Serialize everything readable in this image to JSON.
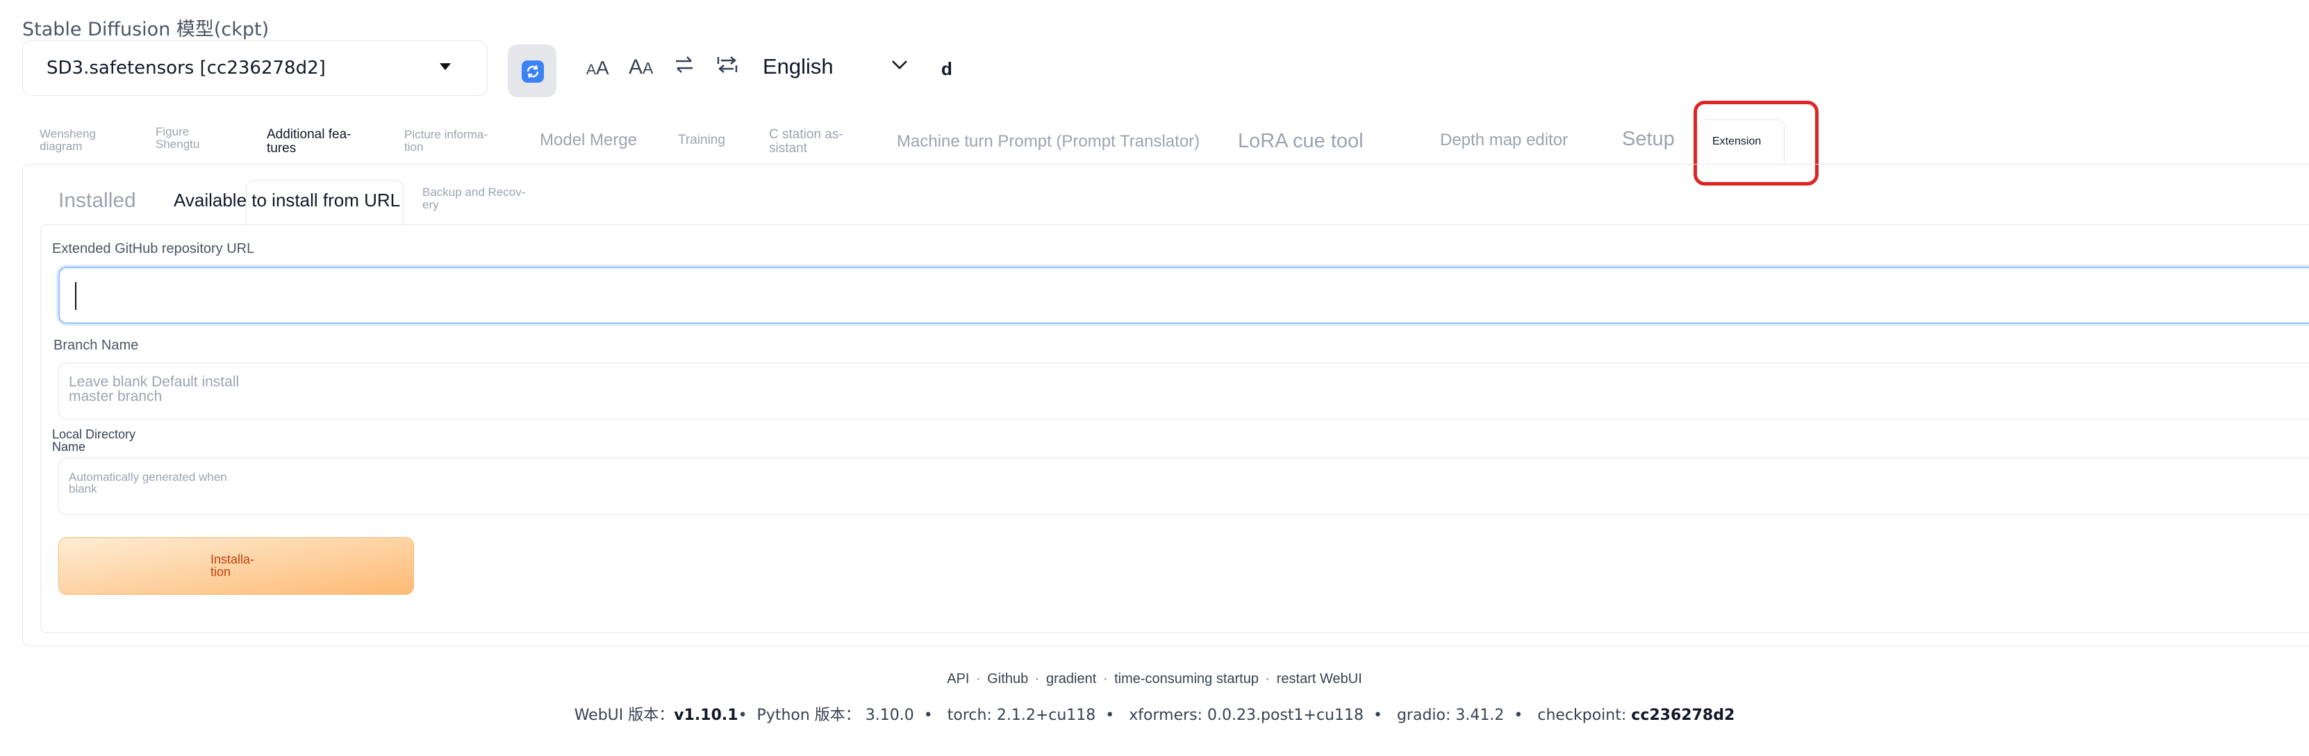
{
  "model": {
    "label": "Stable Diffusion 模型(ckpt)",
    "value": "SD3.safetensors [cc236278d2]"
  },
  "toolbar": {
    "font_small": "AA",
    "font_large": "AA",
    "swap_icon": "swap-arrows-icon",
    "swap_alt_icon": "swap-arrows-alt-icon",
    "language": "English",
    "d_label": "d"
  },
  "tabs": [
    {
      "label": "Wensheng diagram"
    },
    {
      "label": "Figure Shengtu"
    },
    {
      "label": "Additional fea-tures"
    },
    {
      "label": "Picture informa-tion"
    },
    {
      "label": "Model Merge"
    },
    {
      "label": "Training"
    },
    {
      "label": "C station as-sistant"
    },
    {
      "label": "Machine turn Prompt (Prompt Translator)"
    },
    {
      "label": "LoRA cue tool"
    },
    {
      "label": "Depth map editor"
    },
    {
      "label": "Setup"
    },
    {
      "label": "Extension"
    }
  ],
  "subtabs": [
    {
      "label": "Installed"
    },
    {
      "label": "Available to install from URL"
    },
    {
      "label": "Backup and Recov-ery"
    }
  ],
  "form": {
    "url_label": "Extended GitHub repository URL",
    "url_value": "",
    "branch_label": "Branch Name",
    "branch_placeholder": "Leave blank Default install master branch",
    "dir_label": "Local Directory Name",
    "dir_placeholder": "Automatically generated when blank",
    "install_label": "Installa-tion"
  },
  "footer": {
    "links": [
      "API",
      "Github",
      "gradient",
      "time-consuming startup",
      "restart WebUI"
    ],
    "separator": "·",
    "versions": [
      {
        "label": "WebUI 版本：",
        "value": "v1.10.1"
      },
      {
        "label": "Python 版本：",
        "value": "3.10.0"
      },
      {
        "label": "torch:",
        "value": "2.1.2+cu118"
      },
      {
        "label": "xformers:",
        "value": "0.0.23.post1+cu118"
      },
      {
        "label": "gradio:",
        "value": "3.41.2"
      },
      {
        "label": "checkpoint:",
        "value": "cc236278d2"
      }
    ]
  },
  "colors": {
    "highlight": "#dc2626",
    "install_button": "#fdba74",
    "focus_border": "#93c5fd"
  }
}
